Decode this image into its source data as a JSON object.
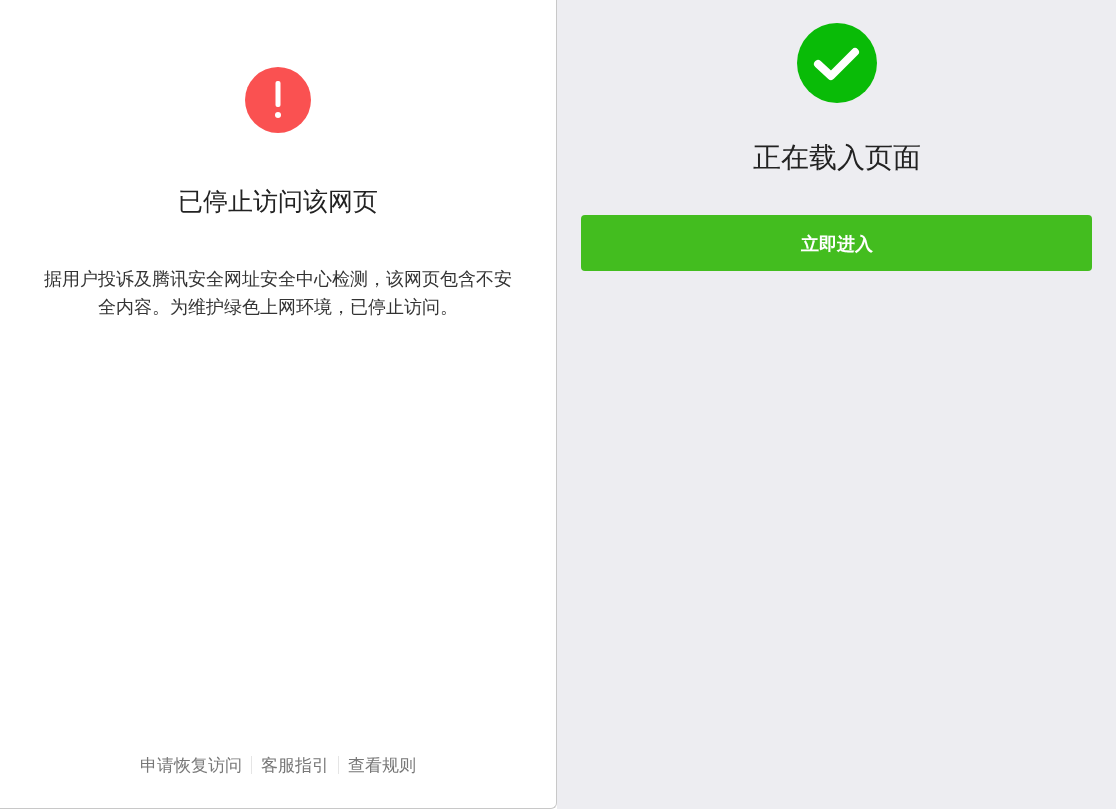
{
  "blocked_page": {
    "title": "已停止访问该网页",
    "message": "据用户投诉及腾讯安全网址安全中心检测，该网页包含不安全内容。为维护绿色上网环境，已停止访问。",
    "footer_links": [
      "申请恢复访问",
      "客服指引",
      "查看规则"
    ]
  },
  "loading_page": {
    "title": "正在载入页面",
    "button": "立即进入"
  }
}
